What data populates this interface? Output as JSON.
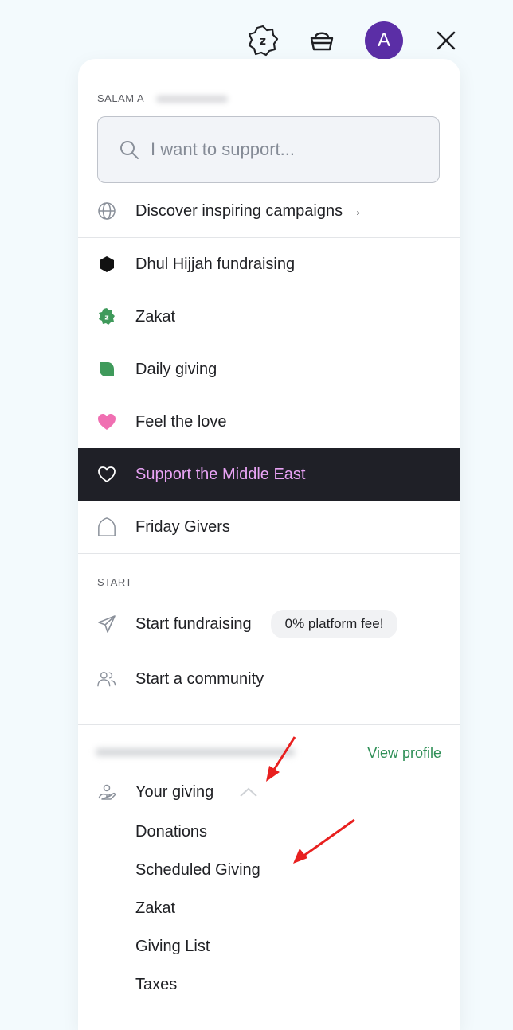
{
  "topbar": {
    "zakat_icon_letter": "z",
    "avatar_letter": "A",
    "icons": [
      "zakat-badge-icon",
      "basket-icon",
      "close-icon"
    ]
  },
  "menu": {
    "greeting": "SALAM A",
    "search": {
      "placeholder": "I want to support..."
    },
    "discover_label": "Discover inspiring campaigns →",
    "items": [
      {
        "label": "Dhul Hijjah fundraising",
        "icon": "hexagon-icon"
      },
      {
        "label": "Zakat",
        "icon": "zakat-badge-icon"
      },
      {
        "label": "Daily giving",
        "icon": "leaf-icon"
      },
      {
        "label": "Feel the love",
        "icon": "heart-icon"
      },
      {
        "label": "Support the Middle East",
        "icon": "heart-outline-icon",
        "active": true
      },
      {
        "label": "Friday Givers",
        "icon": "dome-icon"
      }
    ],
    "start": {
      "title": "START",
      "fundraising_label": "Start fundraising",
      "fee_badge": "0% platform fee!",
      "community_label": "Start a community"
    },
    "profile": {
      "view_profile": "View profile",
      "your_giving_label": "Your giving",
      "sub_items": [
        "Donations",
        "Scheduled Giving",
        "Zakat",
        "Giving List",
        "Taxes"
      ]
    }
  },
  "colors": {
    "avatar": "#5b2ea6",
    "active_bg": "#1f2027",
    "active_text": "#e9a3f5",
    "zakat_green": "#3f9a5b",
    "heart_pink": "#f06fb2",
    "link_green": "#2f8f57",
    "annotation_red": "#e8201f"
  }
}
